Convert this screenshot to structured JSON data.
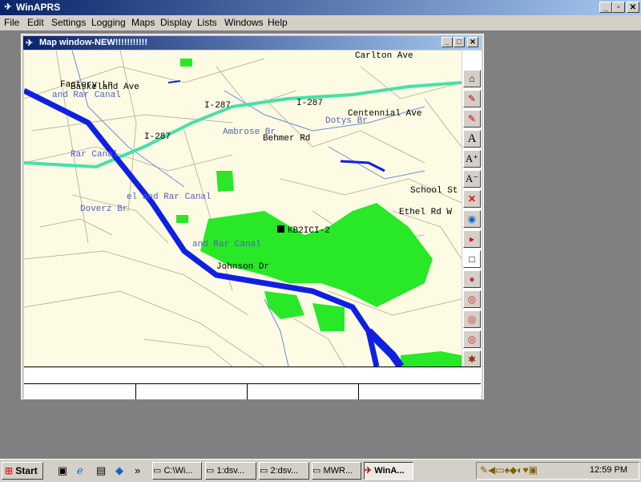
{
  "app": {
    "title": "WinAPRS"
  },
  "window_buttons": {
    "minimize": "_",
    "restore": "▫",
    "close": "✕"
  },
  "menu": [
    "File",
    "Edit",
    "Settings",
    "Logging",
    "Maps",
    "Display",
    "Lists",
    "Windows",
    "Help"
  ],
  "map_window": {
    "title": "Map window-NEW!!!!!!!!!!!"
  },
  "map_labels": [
    {
      "text": "Carlton Ave",
      "color": "#000000"
    },
    {
      "text": "Factory Ln",
      "color": "#000000"
    },
    {
      "text": "Baskeland Ave",
      "color": "#000000"
    },
    {
      "text": "and Rar Canal",
      "color": "#5060c8"
    },
    {
      "text": "I-287",
      "color": "#000000"
    },
    {
      "text": "I-287",
      "color": "#000000"
    },
    {
      "text": "I-287",
      "color": "#000000"
    },
    {
      "text": "Centennial Ave",
      "color": "#000000"
    },
    {
      "text": "Dotys Br",
      "color": "#5060c8"
    },
    {
      "text": "Ambrose Br",
      "color": "#5060c8"
    },
    {
      "text": "Behmer Rd",
      "color": "#000000"
    },
    {
      "text": "Rar Canal",
      "color": "#5060c8"
    },
    {
      "text": "School St",
      "color": "#000000"
    },
    {
      "text": "Ethel Rd W",
      "color": "#000000"
    },
    {
      "text": "el and Rar Canal",
      "color": "#5060c8"
    },
    {
      "text": "Doverz Br",
      "color": "#5060c8"
    },
    {
      "text": "KB2ICI-2",
      "color": "#000000"
    },
    {
      "text": "and Rar Canal",
      "color": "#5060c8"
    },
    {
      "text": "Johnson Dr",
      "color": "#000000"
    }
  ],
  "toolbar_icons": [
    "home-icon",
    "zoom-in-map-icon",
    "zoom-out-map-icon",
    "font-icon",
    "font-larger-icon",
    "font-smaller-icon",
    "close-red-x-icon",
    "globe-icon",
    "flag-icon",
    "blank-icon",
    "balloon-icon",
    "target-icon",
    "target-icon",
    "target-icon",
    "tree-icon",
    "tree-icon"
  ],
  "toolbar_glyphs": [
    "⌂",
    "✎",
    "✎",
    "A",
    "A⁺",
    "A⁻",
    "✕",
    "◉",
    "▸",
    "□",
    "●",
    "◎",
    "◎",
    "◎",
    "✱",
    "✱"
  ],
  "taskbar": {
    "start": "Start",
    "buttons": [
      "C:\\Wi...",
      "1:dsv...",
      "2:dsv...",
      "MWR...",
      "WinA..."
    ],
    "clock": "12:59 PM"
  }
}
